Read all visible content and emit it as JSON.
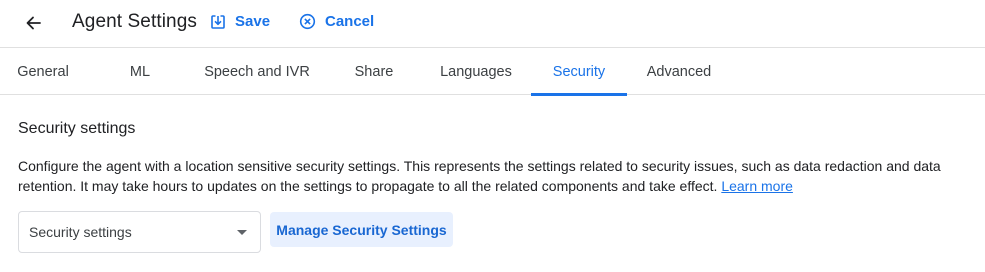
{
  "header": {
    "title": "Agent Settings",
    "back_icon": "arrow-back-icon",
    "save_label": "Save",
    "save_icon": "save-icon",
    "cancel_label": "Cancel",
    "cancel_icon": "cancel-circle-icon"
  },
  "tabs": [
    {
      "label": "General",
      "active": false
    },
    {
      "label": "ML",
      "active": false
    },
    {
      "label": "Speech and IVR",
      "active": false
    },
    {
      "label": "Share",
      "active": false
    },
    {
      "label": "Languages",
      "active": false
    },
    {
      "label": "Security",
      "active": true
    },
    {
      "label": "Advanced",
      "active": false
    }
  ],
  "security": {
    "section_title": "Security settings",
    "description": "Configure the agent with a location sensitive security settings. This represents the settings related to security issues, such as data redaction and data retention. It may take hours to updates on the settings to propagate to all the related components and take effect.",
    "learn_more": "Learn more",
    "select_placeholder": "Security settings",
    "manage_button": "Manage Security Settings"
  },
  "colors": {
    "accent": "#1a73e8",
    "text": "#202124",
    "divider": "#e0e0e0",
    "button_bg": "#e8f0fe"
  }
}
